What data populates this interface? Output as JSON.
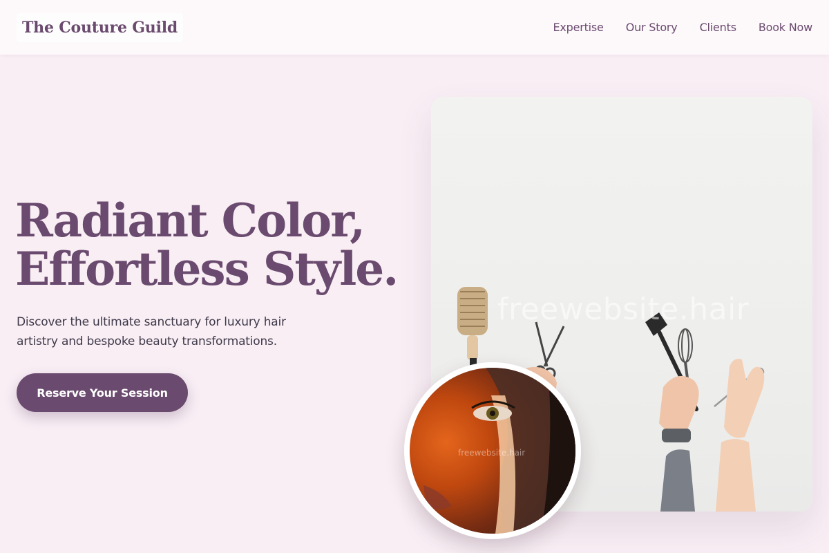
{
  "header": {
    "brand": "The Couture Guild",
    "nav": [
      {
        "label": "Expertise"
      },
      {
        "label": "Our Story"
      },
      {
        "label": "Clients"
      },
      {
        "label": "Book Now"
      }
    ]
  },
  "hero": {
    "headline_line1": "Radiant Color,",
    "headline_line2": "Effortless Style.",
    "tagline": "Discover the ultimate sanctuary for luxury hair artistry and bespoke beauty transformations.",
    "cta_label": "Reserve Your Session"
  },
  "media": {
    "card_watermark": "freewebsite.hair",
    "portrait_watermark": "freewebsite.hair"
  },
  "colors": {
    "brand": "#6a4a6e",
    "background": "#f8eef4",
    "header_bg": "#fdf9fb",
    "body_text": "#3f3a4a"
  }
}
